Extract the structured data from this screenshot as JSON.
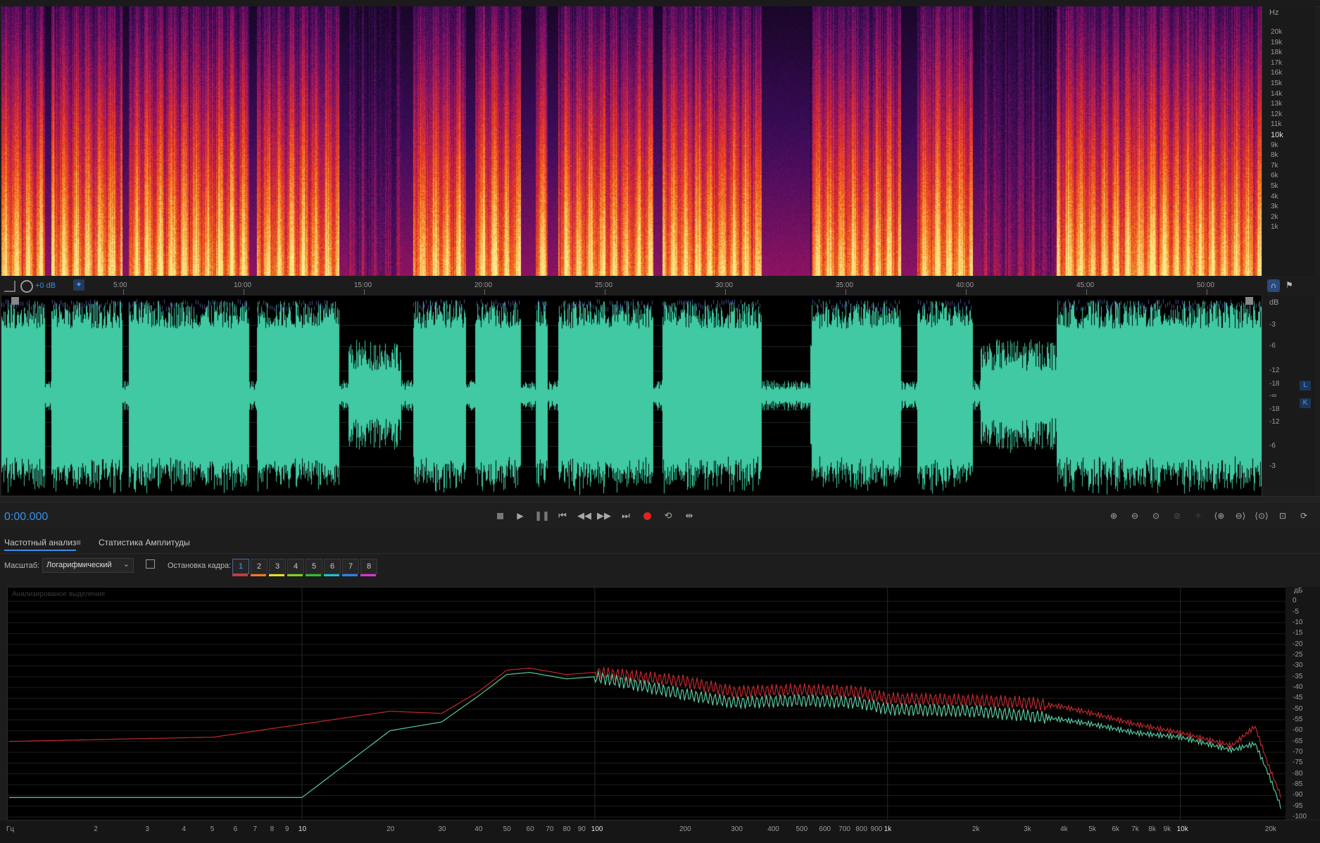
{
  "spectrogram": {
    "unit_label": "Hz",
    "freq_ticks": [
      "20k",
      "19k",
      "18k",
      "17k",
      "16k",
      "15k",
      "14k",
      "13k",
      "12k",
      "11k",
      "10k",
      "9k",
      "8k",
      "7k",
      "6k",
      "5k",
      "4k",
      "3k",
      "2k",
      "1k"
    ],
    "emphasized_tick": "10k"
  },
  "timeline": {
    "gain_label": "+0 dB",
    "ticks": [
      "5:00",
      "10:00",
      "15:00",
      "20:00",
      "25:00",
      "30:00",
      "35:00",
      "40:00",
      "45:00",
      "50:00"
    ]
  },
  "waveform": {
    "unit_label": "dB",
    "db_ticks": [
      "-3",
      "-6",
      "-12",
      "-18",
      "-∞",
      "-18",
      "-12",
      "-6",
      "-3"
    ],
    "channel_labels": [
      "L",
      "K"
    ],
    "color": "#40c9a2"
  },
  "transport": {
    "timecode": "0:00.000",
    "buttons": [
      "stop",
      "play",
      "pause",
      "go-to-start",
      "rewind",
      "fast-forward",
      "go-to-end",
      "record",
      "loop",
      "skip-selection"
    ],
    "zoom_buttons": [
      "zoom-in-amplitude",
      "zoom-out-amplitude",
      "zoom-reset",
      "zoom-disabled-1",
      "zoom-disabled-2",
      "zoom-in-time",
      "zoom-out-time",
      "zoom-full",
      "zoom-selection",
      "zoom-out-full"
    ]
  },
  "panel": {
    "tabs": [
      {
        "label": "Частотный анализ",
        "active": true
      },
      {
        "label": "Статистика Амплитуды",
        "active": false
      }
    ],
    "scale_label": "Масштаб:",
    "scale_value": "Логарифмический",
    "freeze_label": "Остановка кадра:",
    "freeze_slots": [
      {
        "label": "1",
        "color": "#e03030",
        "active": true
      },
      {
        "label": "2",
        "color": "#f07820"
      },
      {
        "label": "3",
        "color": "#e8e020"
      },
      {
        "label": "4",
        "color": "#80d020"
      },
      {
        "label": "5",
        "color": "#30c030"
      },
      {
        "label": "6",
        "color": "#20c0d0"
      },
      {
        "label": "7",
        "color": "#3080f0"
      },
      {
        "label": "8",
        "color": "#e030d0"
      }
    ]
  },
  "frequency_analysis": {
    "overlay_text": "Анализированое выделение",
    "db_unit": "дБ",
    "db_ticks": [
      "0",
      "-5",
      "-10",
      "-15",
      "-20",
      "-25",
      "-30",
      "-35",
      "-40",
      "-45",
      "-50",
      "-55",
      "-60",
      "-65",
      "-70",
      "-75",
      "-80",
      "-85",
      "-90",
      "-95",
      "-100"
    ],
    "hz_unit": "Гц",
    "hz_ticks": [
      "2",
      "3",
      "4",
      "5",
      "6",
      "7",
      "8",
      "9",
      "10",
      "20",
      "30",
      "40",
      "50",
      "60",
      "70",
      "80",
      "90",
      "100",
      "200",
      "300",
      "400",
      "500",
      "600",
      "700",
      "800",
      "900",
      "1k",
      "2k",
      "3k",
      "4k",
      "5k",
      "6k",
      "7k",
      "8k",
      "9k",
      "10k",
      "20k"
    ]
  },
  "chart_data": {
    "type": "line",
    "xlabel": "Гц",
    "ylabel": "дБ",
    "x_scale": "log",
    "xlim": [
      1,
      22000
    ],
    "ylim": [
      -100,
      5
    ],
    "x": [
      1,
      5,
      10,
      20,
      30,
      40,
      50,
      60,
      80,
      100,
      200,
      300,
      500,
      800,
      1000,
      2000,
      3000,
      4000,
      5000,
      7000,
      10000,
      15000,
      18000,
      20000,
      22000
    ],
    "series": [
      {
        "color": "#c0282c",
        "values": [
          -65,
          -63,
          -57,
          -51,
          -52,
          -42,
          -32,
          -31,
          -34,
          -33,
          -37,
          -42,
          -41,
          -42,
          -45,
          -46,
          -47,
          -49,
          -52,
          -57,
          -61,
          -67,
          -58,
          -76,
          -90
        ]
      },
      {
        "color": "#58c8a0",
        "values": [
          -91,
          -91,
          -91,
          -60,
          -56,
          -44,
          -34,
          -33,
          -36,
          -35,
          -43,
          -47,
          -46,
          -47,
          -50,
          -51,
          -53,
          -55,
          -57,
          -61,
          -63,
          -69,
          -66,
          -80,
          -95
        ]
      }
    ]
  }
}
